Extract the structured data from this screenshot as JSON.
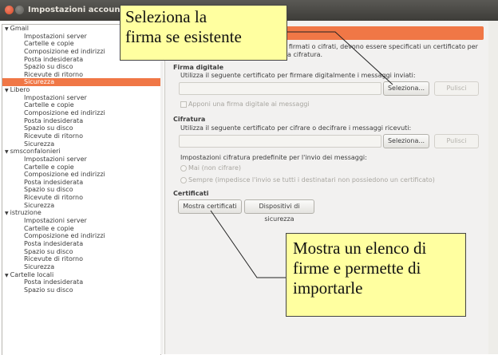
{
  "window": {
    "title": "Impostazioni account"
  },
  "accounts": [
    {
      "name": "Gmail",
      "items": [
        "Impostazioni server",
        "Cartelle e copie",
        "Composizione ed indirizzi",
        "Posta indesiderata",
        "Spazio su disco",
        "Ricevute di ritorno",
        "Sicurezza"
      ]
    },
    {
      "name": "Libero",
      "items": [
        "Impostazioni server",
        "Cartelle e copie",
        "Composizione ed indirizzi",
        "Posta indesiderata",
        "Spazio su disco",
        "Ricevute di ritorno",
        "Sicurezza"
      ]
    },
    {
      "name": "smsconfalonieri",
      "items": [
        "Impostazioni server",
        "Cartelle e copie",
        "Composizione ed indirizzi",
        "Posta indesiderata",
        "Spazio su disco",
        "Ricevute di ritorno",
        "Sicurezza"
      ]
    },
    {
      "name": "istruzione",
      "items": [
        "Impostazioni server",
        "Cartelle e copie",
        "Composizione ed indirizzi",
        "Posta indesiderata",
        "Spazio su disco",
        "Ricevute di ritorno",
        "Sicurezza"
      ]
    },
    {
      "name": "Cartelle locali",
      "items": [
        "Posta indesiderata",
        "Spazio su disco"
      ]
    }
  ],
  "selected": {
    "account_index": 0,
    "item_label": "Sicurezza"
  },
  "security": {
    "intro_line1": "gi firmati o cifrati, devono essere specificati un certificato per",
    "intro_line2": "r la cifratura.",
    "signing_title": "Firma digitale",
    "signing_desc": "Utilizza il seguente certificato per firmare digitalmente i messaggi inviati:",
    "signing_select": "Seleziona...",
    "signing_clear": "Pulisci",
    "sign_default": "Apponi una firma digitale ai messaggi",
    "encryption_title": "Cifratura",
    "encryption_desc": "Utilizza il seguente certificato per cifrare o decifrare i messaggi ricevuti:",
    "encryption_select": "Seleziona...",
    "encryption_clear": "Pulisci",
    "encryption_default_label": "Impostazioni cifratura predefinite per l'invio dei messaggi:",
    "encryption_never": "Mai (non cifrare)",
    "encryption_always": "Sempre (impedisce l'invio se tutti i destinatari non possiedono un certificato)",
    "certificates_title": "Certificati",
    "show_certificates": "Mostra certificati",
    "security_devices": "Dispositivi di sicurezza"
  },
  "callouts": {
    "top_line1": "Seleziona la",
    "top_line2": "firma se esistente",
    "bottom_line1": "Mostra un elenco di",
    "bottom_line2": "firme e permette di",
    "bottom_line3": "importarle"
  },
  "colors": {
    "accent": "#f07746",
    "callout_bg": "#ffffa0",
    "titlebar": "#3d3c38"
  }
}
